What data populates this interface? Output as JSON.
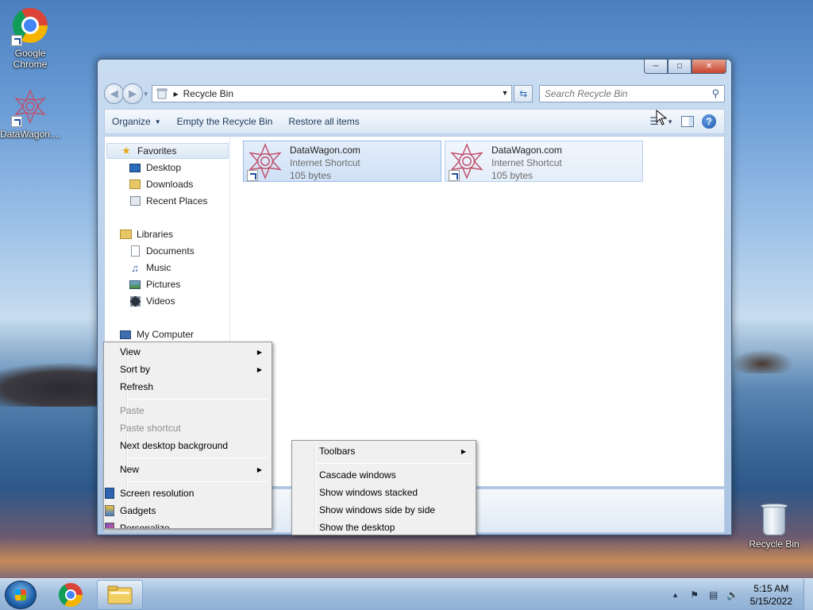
{
  "desktop": {
    "icons": [
      {
        "label": "Google\nChrome",
        "label_line1": "Google",
        "label_line2": "Chrome",
        "icon": "chrome-icon"
      },
      {
        "label": "DataWagon....",
        "icon": "datawagon-icon"
      },
      {
        "label": "Recycle Bin",
        "icon": "recycle-bin-icon"
      }
    ]
  },
  "window": {
    "address": {
      "path": "Recycle Bin",
      "icon": "recycle-bin-icon"
    },
    "search": {
      "placeholder": "Search Recycle Bin"
    },
    "toolbar": {
      "organize": "Organize",
      "empty": "Empty the Recycle Bin",
      "restore": "Restore all items"
    },
    "nav": {
      "favorites": "Favorites",
      "desktop": "Desktop",
      "downloads": "Downloads",
      "recent": "Recent Places",
      "libraries": "Libraries",
      "documents": "Documents",
      "music": "Music",
      "pictures": "Pictures",
      "videos": "Videos",
      "computer": "My Computer"
    },
    "items": [
      {
        "name": "DataWagon.com",
        "type": "Internet Shortcut",
        "size": "105 bytes"
      },
      {
        "name": "DataWagon.com",
        "type": "Internet Shortcut",
        "size": "105 bytes"
      }
    ]
  },
  "desktop_menu": {
    "view": "View",
    "sort_by": "Sort by",
    "refresh": "Refresh",
    "paste": "Paste",
    "paste_shortcut": "Paste shortcut",
    "next_bg": "Next desktop background",
    "new": "New",
    "screen_res": "Screen resolution",
    "gadgets": "Gadgets",
    "personalize": "Personalize"
  },
  "taskbar_menu": {
    "toolbars": "Toolbars",
    "cascade": "Cascade windows",
    "stacked": "Show windows stacked",
    "side_by_side": "Show windows side by side",
    "show_desktop": "Show the desktop"
  },
  "taskbar": {
    "time": "5:15 AM",
    "date": "5/15/2022"
  },
  "colors": {
    "selection_blue": "#cfe0f6",
    "toolbar_text": "#1e395b",
    "close_red": "#c7462f"
  }
}
